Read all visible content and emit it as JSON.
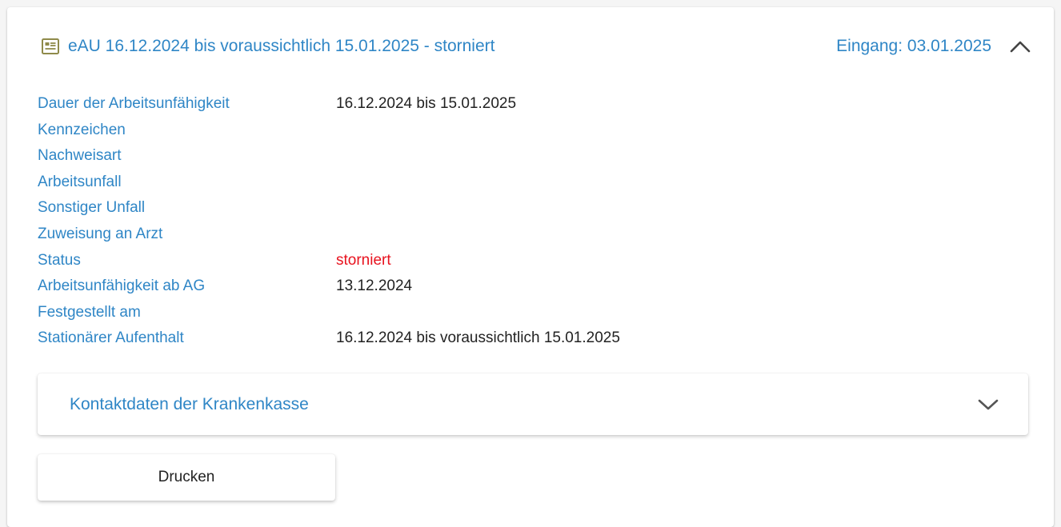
{
  "header": {
    "icon": "document-icon",
    "title": "eAU 16.12.2024 bis voraussichtlich 15.01.2025 - storniert",
    "received": "Eingang: 03.01.2025",
    "toggle_icon": "chevron-up-icon"
  },
  "details": [
    {
      "label": "Dauer der Arbeitsunfähigkeit",
      "value": "16.12.2024 bis 15.01.2025"
    },
    {
      "label": "Kennzeichen",
      "value": ""
    },
    {
      "label": "Nachweisart",
      "value": ""
    },
    {
      "label": "Arbeitsunfall",
      "value": ""
    },
    {
      "label": "Sonstiger Unfall",
      "value": ""
    },
    {
      "label": "Zuweisung an Arzt",
      "value": ""
    },
    {
      "label": "Status",
      "value": "storniert"
    },
    {
      "label": "Arbeitsunfähigkeit ab AG",
      "value": "13.12.2024"
    },
    {
      "label": "Festgestellt am",
      "value": ""
    },
    {
      "label": "Stationärer Aufenthalt",
      "value": "16.12.2024 bis voraussichtlich 15.01.2025"
    }
  ],
  "contact_panel": {
    "label": "Kontaktdaten der Krankenkasse",
    "toggle_icon": "chevron-down-icon"
  },
  "actions": {
    "print_label": "Drucken"
  },
  "colors": {
    "accent": "#2f86c6",
    "status_cancelled": "#e8121e",
    "icon_olive": "#8f8a4a"
  }
}
